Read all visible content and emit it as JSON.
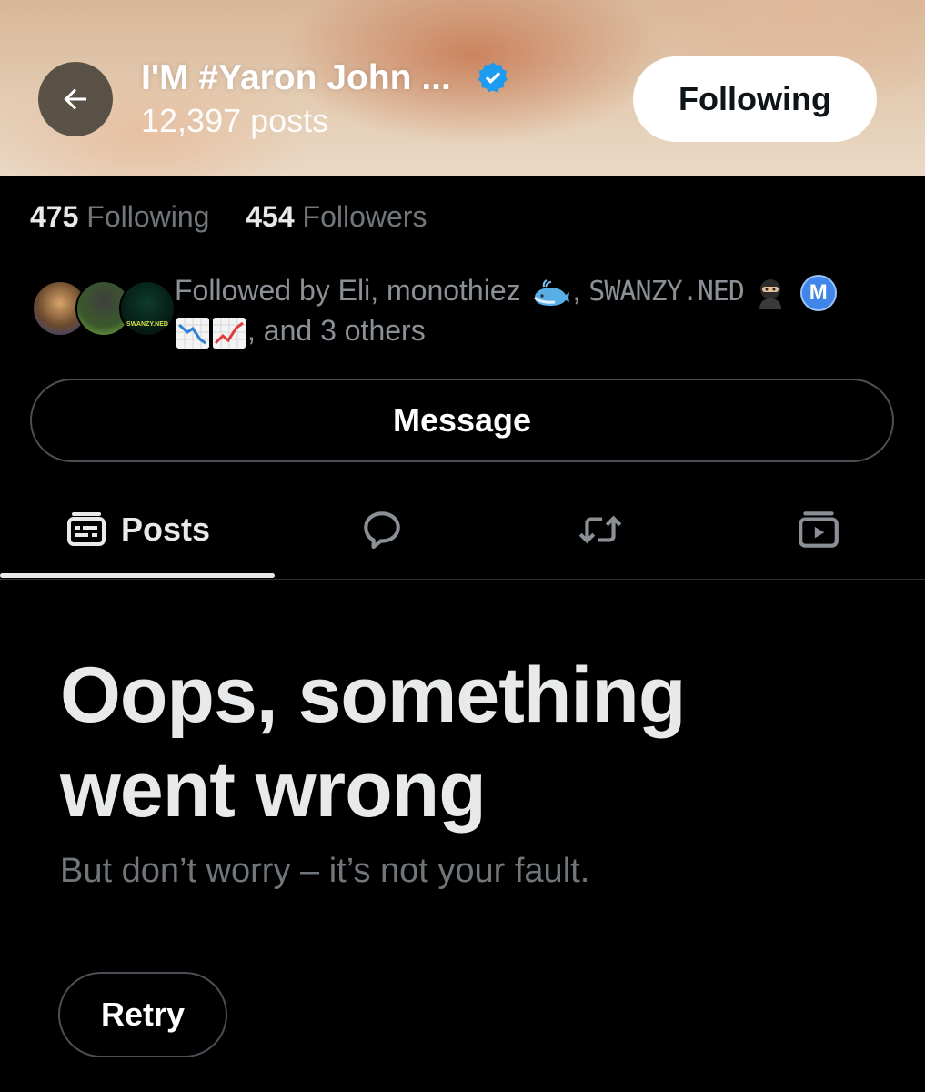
{
  "header": {
    "profile_name": "I'M #Yaron John ...",
    "post_count": "12,397 posts",
    "follow_button": "Following",
    "verified": true
  },
  "stats": {
    "following_count": "475",
    "following_label": "Following",
    "followers_count": "454",
    "followers_label": "Followers"
  },
  "followed_by": {
    "prefix": "Followed by Eli, monothiez",
    "separator": ",",
    "swanzy_name": "SWANZY.NED",
    "m_badge": "M",
    "suffix": ", and 3 others",
    "avatar3_tag": "SWANZY.NED"
  },
  "actions": {
    "message_label": "Message"
  },
  "tabs": [
    {
      "label": "Posts",
      "icon": "posts-icon",
      "active": true
    },
    {
      "label": "",
      "icon": "replies-icon",
      "active": false
    },
    {
      "label": "",
      "icon": "repost-icon",
      "active": false
    },
    {
      "label": "",
      "icon": "media-icon",
      "active": false
    }
  ],
  "error": {
    "title": "Oops, something went wrong",
    "subtitle": "But don’t worry – it’s not your fault.",
    "retry_label": "Retry"
  },
  "colors": {
    "background": "#000000",
    "text_primary": "#e7e9ea",
    "text_secondary": "#71767b",
    "verified_blue": "#1d9bf0",
    "border": "#4c5056"
  }
}
